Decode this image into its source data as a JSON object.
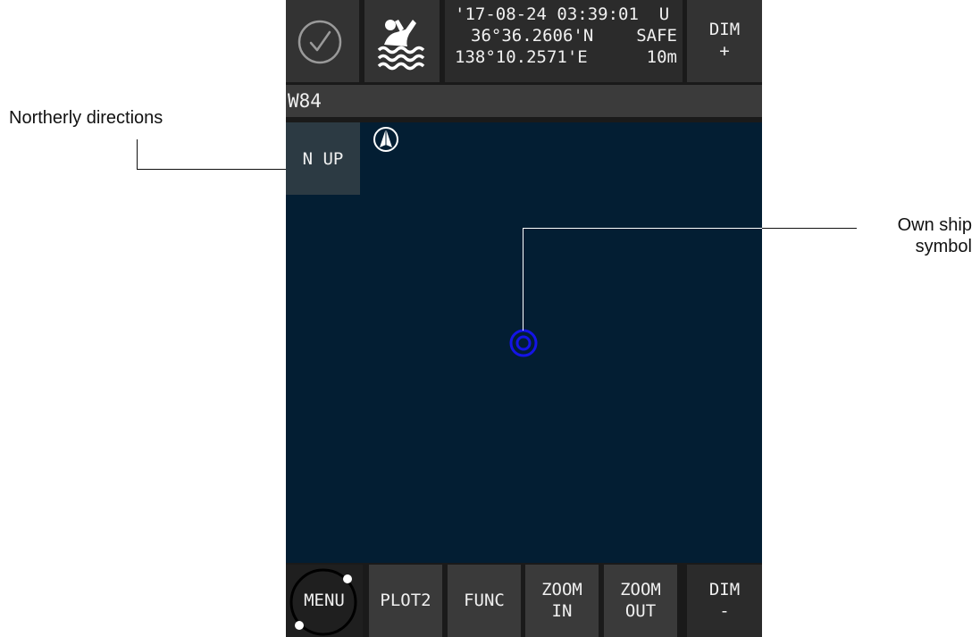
{
  "top_bar": {
    "status": {
      "line1": "'17-08-24 03:39:01  U",
      "line2": "36°36.2606'N",
      "line2_right": "SAFE",
      "line3": "138°10.2571'E",
      "line3_right": "10m"
    },
    "dim_plus": {
      "line1": "DIM",
      "line2": "+"
    }
  },
  "datum": "W84",
  "chart": {
    "orientation_button": "N UP"
  },
  "bottom_bar": {
    "menu": "MENU",
    "plot2": "PLOT2",
    "func": "FUNC",
    "zoom_in": {
      "line1": "ZOOM",
      "line2": "IN"
    },
    "zoom_out": {
      "line1": "ZOOM",
      "line2": "OUT"
    },
    "dim_minus": {
      "line1": "DIM",
      "line2": "-"
    }
  },
  "annotations": {
    "northerly": "Northerly directions",
    "own_ship_line1": "Own ship",
    "own_ship_line2": "symbol"
  },
  "colors": {
    "chart_background": "#031e33",
    "own_ship": "#1414e6"
  },
  "icons": [
    "check-circle-icon",
    "man-overboard-icon",
    "north-arrow-icon",
    "own-ship-icon",
    "menu-dial-icon"
  ]
}
